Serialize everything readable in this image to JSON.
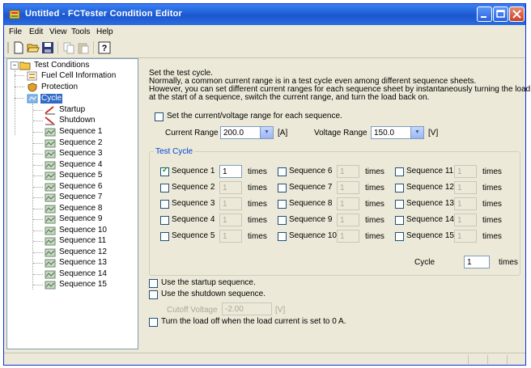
{
  "window": {
    "title": "Untitled - FCTester Condition Editor"
  },
  "menu": [
    "File",
    "Edit",
    "View",
    "Tools",
    "Help"
  ],
  "toolbar": {
    "icons": [
      "new-icon",
      "open-icon",
      "save-icon",
      "copy-icon",
      "paste-icon",
      "help-icon"
    ]
  },
  "tree": {
    "root": "Test Conditions",
    "items": [
      "Fuel Cell Information",
      "Protection",
      "Cycle"
    ],
    "cycle_children": [
      "Startup",
      "Shutdown"
    ],
    "sequences": [
      "Sequence 1",
      "Sequence 2",
      "Sequence 3",
      "Sequence 4",
      "Sequence 5",
      "Sequence 6",
      "Sequence 7",
      "Sequence 8",
      "Sequence 9",
      "Sequence 10",
      "Sequence 11",
      "Sequence 12",
      "Sequence 13",
      "Sequence 14",
      "Sequence 15"
    ],
    "selected": "Cycle"
  },
  "panel": {
    "desc1": "Set the test cycle.",
    "desc2": "Normally, a common current range is in a test cycle even among different sequence sheets.",
    "desc3": "However, you can set different current ranges for each sequence sheet by instantaneously turning the load off",
    "desc4": "at the start of a sequence, switch the current range, and turn the load back on.",
    "range_check_label": "Set the current/voltage range for each sequence.",
    "current_range_label": "Current Range",
    "current_range_value": "200.0",
    "current_unit": "[A]",
    "voltage_range_label": "Voltage Range",
    "voltage_range_value": "150.0",
    "voltage_unit": "[V]",
    "test_cycle_legend": "Test Cycle",
    "times_label": "times",
    "sequences": [
      {
        "label": "Sequence 1",
        "value": "1",
        "checked": true
      },
      {
        "label": "Sequence 2",
        "value": "1",
        "checked": false
      },
      {
        "label": "Sequence 3",
        "value": "1",
        "checked": false
      },
      {
        "label": "Sequence 4",
        "value": "1",
        "checked": false
      },
      {
        "label": "Sequence 5",
        "value": "1",
        "checked": false
      },
      {
        "label": "Sequence 6",
        "value": "1",
        "checked": false
      },
      {
        "label": "Sequence 7",
        "value": "1",
        "checked": false
      },
      {
        "label": "Sequence 8",
        "value": "1",
        "checked": false
      },
      {
        "label": "Sequence 9",
        "value": "1",
        "checked": false
      },
      {
        "label": "Sequence 10",
        "value": "1",
        "checked": false
      },
      {
        "label": "Sequence 11",
        "value": "1",
        "checked": false
      },
      {
        "label": "Sequence 12",
        "value": "1",
        "checked": false
      },
      {
        "label": "Sequence 13",
        "value": "1",
        "checked": false
      },
      {
        "label": "Sequence 14",
        "value": "1",
        "checked": false
      },
      {
        "label": "Sequence 15",
        "value": "1",
        "checked": false
      }
    ],
    "cycle_label": "Cycle",
    "cycle_value": "1",
    "startup_label": "Use the startup sequence.",
    "shutdown_label": "Use the shutdown sequence.",
    "cutoff_label": "Cutoff Voltage",
    "cutoff_value": "-2.00",
    "cutoff_unit": "[V]",
    "load_off_label": "Turn the load off when the load current is set to 0 A."
  },
  "colors": {
    "titlebar": "#1f5fd6",
    "selection": "#316ac5",
    "legend": "#0046d5",
    "window_bg": "#ece9d8"
  }
}
